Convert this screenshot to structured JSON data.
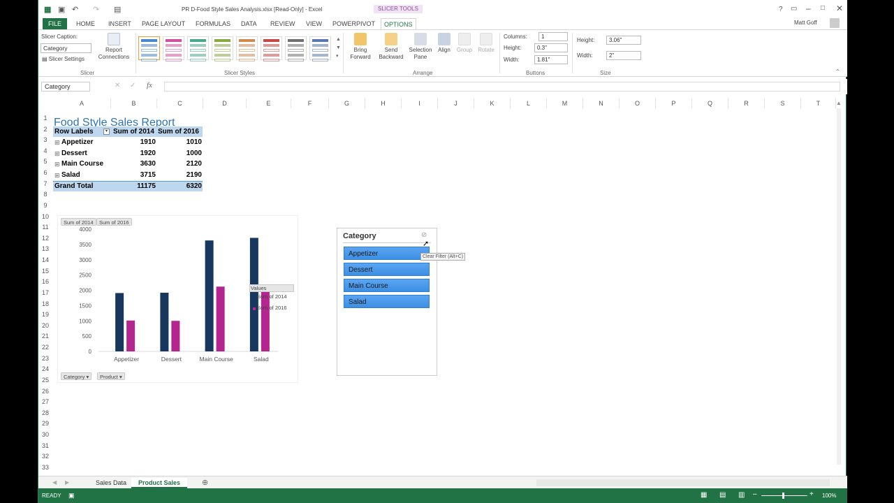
{
  "window": {
    "title": "PR D-Food Style Sales Analysis.xlsx  [Read-Only] - Excel",
    "contextual_tab": "SLICER TOOLS",
    "user": "Matt Goff",
    "help": "?"
  },
  "ribbon_tabs": [
    "FILE",
    "HOME",
    "INSERT",
    "PAGE LAYOUT",
    "FORMULAS",
    "DATA",
    "REVIEW",
    "VIEW",
    "POWERPIVOT",
    "OPTIONS"
  ],
  "ribbon": {
    "slicer_caption_label": "Slicer Caption:",
    "slicer_caption_value": "Category",
    "report_connections": [
      "Report",
      "Connections"
    ],
    "slicer_settings": "Slicer Settings",
    "group_slicer": "Slicer",
    "group_styles": "Slicer Styles",
    "bring_forward": [
      "Bring",
      "Forward"
    ],
    "send_backward": [
      "Send",
      "Backward"
    ],
    "selection_pane": [
      "Selection",
      "Pane"
    ],
    "align": "Align",
    "group_btn": "Group",
    "rotate": "Rotate",
    "group_arrange": "Arrange",
    "columns_label": "Columns:",
    "columns_value": "1",
    "bheight_label": "Height:",
    "bheight_value": "0.3\"",
    "bwidth_label": "Width:",
    "bwidth_value": "1.81\"",
    "group_buttons": "Buttons",
    "height_label": "Height:",
    "height_value": "3.06\"",
    "width_label": "Width:",
    "width_value": "2\"",
    "group_size": "Size",
    "style_colors": [
      "#4a86c8",
      "#d44f9a",
      "#4aa88a",
      "#8aa840",
      "#d08a50",
      "#c84848",
      "#707070",
      "#5a78b0"
    ]
  },
  "formula_bar": {
    "name_box": "Category",
    "fx": "fx"
  },
  "columns": [
    "A",
    "B",
    "C",
    "D",
    "E",
    "F",
    "G",
    "H",
    "I",
    "J",
    "K",
    "L",
    "M",
    "N",
    "O",
    "P",
    "Q",
    "R",
    "S",
    "T"
  ],
  "rows": [
    "1",
    "2",
    "3",
    "4",
    "5",
    "6",
    "7",
    "8",
    "9",
    "10",
    "11",
    "12",
    "13",
    "14",
    "15",
    "16",
    "17",
    "18",
    "19",
    "20",
    "21",
    "22",
    "23",
    "24",
    "25",
    "26",
    "27",
    "28",
    "29",
    "30",
    "31",
    "32",
    "33"
  ],
  "report": {
    "title": "Food Style Sales Report",
    "headers": [
      "Row Labels",
      "Sum of 2014",
      "Sum of 2016"
    ],
    "rows": [
      {
        "label": "Appetizer",
        "v2014": "1910",
        "v2016": "1010"
      },
      {
        "label": "Dessert",
        "v2014": "1920",
        "v2016": "1000"
      },
      {
        "label": "Main Course",
        "v2014": "3630",
        "v2016": "2120"
      },
      {
        "label": "Salad",
        "v2014": "3715",
        "v2016": "2190"
      }
    ],
    "grand_total": {
      "label": "Grand Total",
      "v2014": "11175",
      "v2016": "6320"
    },
    "expand_glyph": "⊞"
  },
  "chart_data": {
    "type": "bar",
    "categories": [
      "Appetizer",
      "Dessert",
      "Main Course",
      "Salad"
    ],
    "series": [
      {
        "name": "Sum of 2014",
        "values": [
          1910,
          1920,
          3630,
          3715
        ],
        "color": "#17375e"
      },
      {
        "name": "Sum of 2016",
        "values": [
          1010,
          1000,
          2120,
          2190
        ],
        "color": "#b5258f"
      }
    ],
    "ylim": [
      0,
      4000
    ],
    "yticks": [
      "0",
      "500",
      "1000",
      "1500",
      "2000",
      "2500",
      "3000",
      "3500",
      "4000"
    ],
    "legend_title": "Values",
    "legend_position": "right",
    "value_buttons": [
      "Sum of 2014",
      "Sum of 2016"
    ],
    "axis_buttons": [
      "Category",
      "Product"
    ]
  },
  "slicer": {
    "caption": "Category",
    "items": [
      "Appetizer",
      "Dessert",
      "Main Course",
      "Salad"
    ],
    "tooltip": "Clear Filter (Alt+C)"
  },
  "sheet_tabs": [
    "Sales Data",
    "Product Sales"
  ],
  "status": {
    "ready": "READY",
    "zoom": "100%"
  }
}
